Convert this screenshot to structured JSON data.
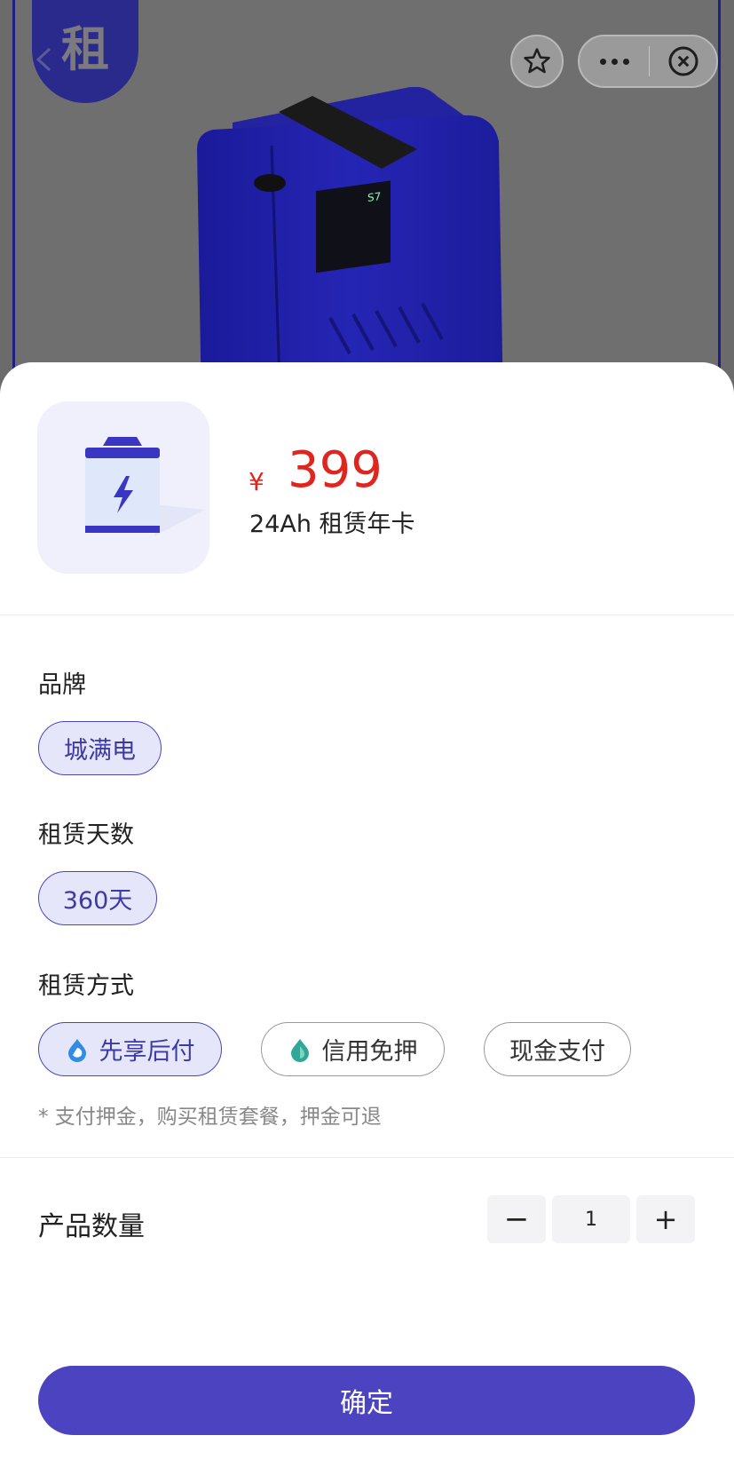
{
  "hero": {
    "badge_text": "租"
  },
  "header": {
    "favorite_icon": "star-outline-icon",
    "more_icon": "more-dots-icon",
    "close_icon": "close-circle-icon"
  },
  "product": {
    "currency": "¥",
    "price": "399",
    "name": "24Ah 租赁年卡",
    "thumbnail_icon": "battery-bolt-icon"
  },
  "options": {
    "brand": {
      "label": "品牌",
      "choices": [
        "城满电"
      ]
    },
    "days": {
      "label": "租赁天数",
      "choices": [
        "360天"
      ]
    },
    "method": {
      "label": "租赁方式",
      "choices": [
        "先享后付",
        "信用免押",
        "现金支付"
      ],
      "selected": "先享后付"
    },
    "note": "* 支付押金，购买租赁套餐，押金可退"
  },
  "quantity": {
    "label": "产品数量",
    "minus": "−",
    "value": "1",
    "plus": "+"
  },
  "confirm_label": "确定",
  "colors": {
    "accent": "#4b43c0",
    "price": "#e0251f",
    "chip_selected_bg": "#e6e6fb"
  }
}
